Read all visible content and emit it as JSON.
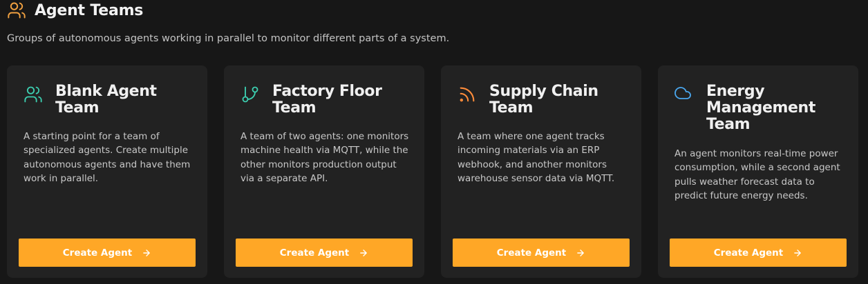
{
  "header": {
    "title": "Agent Teams",
    "subtitle": "Groups of autonomous agents working in parallel to monitor different parts of a system."
  },
  "colors": {
    "accent": "#ffa726",
    "header_icon": "#f0a040",
    "teal_icon": "#3ccfb0",
    "orange_icon": "#ff8c3a",
    "blue_icon": "#4aa8f0"
  },
  "cards": [
    {
      "icon": "users-icon",
      "title": "Blank Agent Team",
      "description": "A starting point for a team of specialized agents. Create multiple autonomous agents and have them work in parallel.",
      "button_label": "Create Agent"
    },
    {
      "icon": "git-branch-icon",
      "title": "Factory Floor Team",
      "description": "A team of two agents: one monitors machine health via MQTT, while the other monitors production output via a separate API.",
      "button_label": "Create Agent"
    },
    {
      "icon": "rss-icon",
      "title": "Supply Chain Team",
      "description": "A team where one agent tracks incoming materials via an ERP webhook, and another monitors warehouse sensor data via MQTT.",
      "button_label": "Create Agent"
    },
    {
      "icon": "cloud-icon",
      "title": "Energy Management Team",
      "description": "An agent monitors real-time power consumption, while a second agent pulls weather forecast data to predict future energy needs.",
      "button_label": "Create Agent"
    }
  ]
}
